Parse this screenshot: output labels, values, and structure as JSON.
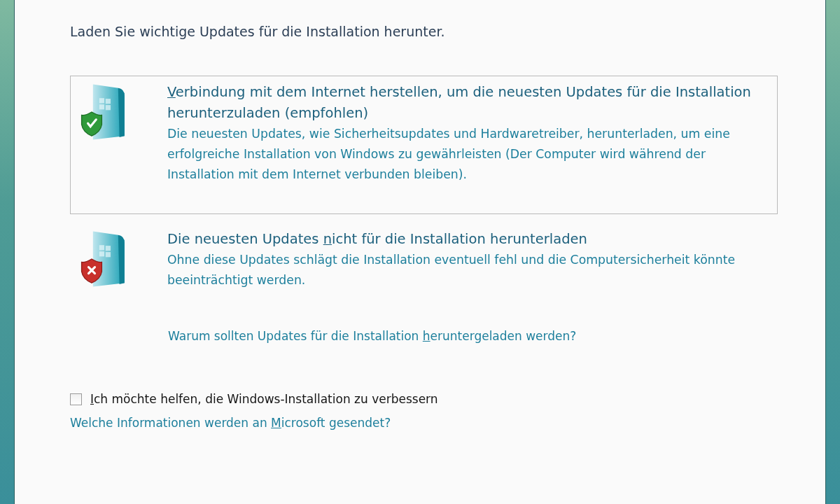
{
  "heading": "Laden Sie wichtige Updates für die Installation herunter.",
  "options": [
    {
      "kind": "ok",
      "selected": true,
      "title": {
        "key": "V",
        "post": "erbindung mit dem Internet herstellen, um die neuesten Updates für die Installation herunterzuladen (empfohlen)"
      },
      "description": "Die neuesten Updates, wie Sicherheitsupdates und Hardwaretreiber, herunterladen, um eine erfolgreiche Installation von Windows zu gewährleisten (Der Computer wird während der Installation mit dem Internet verbunden bleiben)."
    },
    {
      "kind": "error",
      "selected": false,
      "title": {
        "pre": "Die neuesten Updates ",
        "key": "n",
        "post": "icht für die Installation herunterladen"
      },
      "description": "Ohne diese Updates schlägt die Installation eventuell fehl und die Computersicherheit könnte beeinträchtigt werden."
    }
  ],
  "why_link": {
    "pre": "Warum sollten Updates für die Installation ",
    "key": "h",
    "post": "eruntergeladen werden?"
  },
  "checkbox": {
    "checked": false,
    "label": {
      "key": "I",
      "post": "ch möchte helfen, die Windows-Installation zu verbessern"
    }
  },
  "info_link": {
    "pre": "Welche Informationen werden an ",
    "key": "M",
    "post": "icrosoft gesendet?"
  }
}
